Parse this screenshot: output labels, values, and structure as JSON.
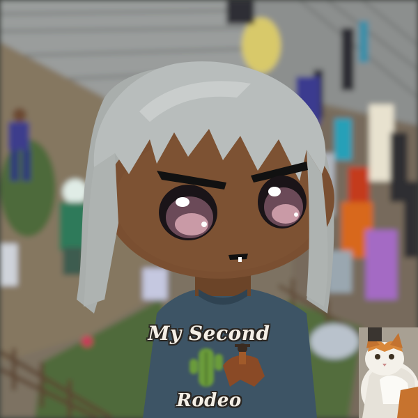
{
  "scene": {
    "avatar": {
      "shirt_text_line1": "My Second",
      "shirt_text_line2": "Rodeo",
      "skin_color": "#7a4f31",
      "hair_color": "#b8bdbc",
      "shirt_color": "#3d5465"
    },
    "background": {
      "ground_color": "#7d7262",
      "stairs_color": "#8c8f8e",
      "grass_color": "#4d6a3a"
    },
    "overlays": {
      "sticker_subject": "cat",
      "shirt_graphics": [
        "cactus",
        "bronco-rider"
      ]
    }
  }
}
